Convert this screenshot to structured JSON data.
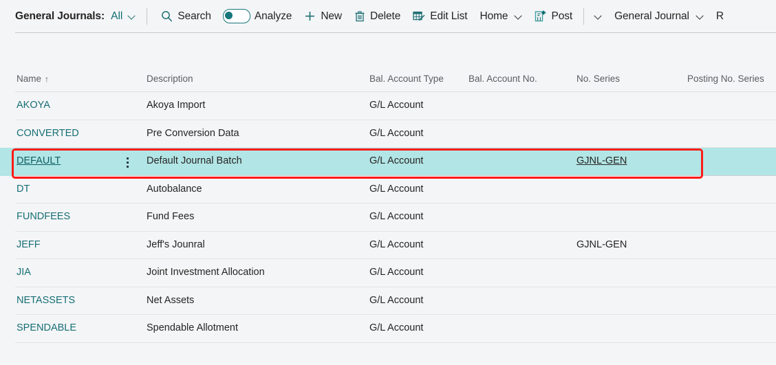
{
  "toolbar": {
    "page_title": "General Journals:",
    "filter_value": "All",
    "search_label": "Search",
    "analyze_label": "Analyze",
    "analyze_toggle_state": "off",
    "new_label": "New",
    "delete_label": "Delete",
    "edit_list_label": "Edit List",
    "home_label": "Home",
    "post_label": "Post",
    "general_journal_label": "General Journal",
    "overflow_label": "R",
    "accent_color": "#17777c",
    "link_color": "#166f74"
  },
  "grid": {
    "columns": [
      {
        "key": "name",
        "label": "Name",
        "sorted": true,
        "sort_indicator": "↑"
      },
      {
        "key": "description",
        "label": "Description"
      },
      {
        "key": "bal_account_type",
        "label": "Bal. Account Type"
      },
      {
        "key": "bal_account_no",
        "label": "Bal. Account No."
      },
      {
        "key": "no_series",
        "label": "No. Series"
      },
      {
        "key": "posting_no_series",
        "label": "Posting No. Series"
      }
    ],
    "rows": [
      {
        "name": "AKOYA",
        "description": "Akoya Import",
        "bal_account_type": "G/L Account",
        "bal_account_no": "",
        "no_series": "",
        "posting_no_series": "",
        "selected": false
      },
      {
        "name": "CONVERTED",
        "description": "Pre Conversion Data",
        "bal_account_type": "G/L Account",
        "bal_account_no": "",
        "no_series": "",
        "posting_no_series": "",
        "selected": false
      },
      {
        "name": "DEFAULT",
        "description": "Default Journal Batch",
        "bal_account_type": "G/L Account",
        "bal_account_no": "",
        "no_series": "GJNL-GEN",
        "posting_no_series": "",
        "selected": true
      },
      {
        "name": "DT",
        "description": "Autobalance",
        "bal_account_type": "G/L Account",
        "bal_account_no": "",
        "no_series": "",
        "posting_no_series": "",
        "selected": false
      },
      {
        "name": "FUNDFEES",
        "description": "Fund Fees",
        "bal_account_type": "G/L Account",
        "bal_account_no": "",
        "no_series": "",
        "posting_no_series": "",
        "selected": false
      },
      {
        "name": "JEFF",
        "description": "Jeff's Jounral",
        "bal_account_type": "G/L Account",
        "bal_account_no": "",
        "no_series": "GJNL-GEN",
        "posting_no_series": "",
        "selected": false
      },
      {
        "name": "JIA",
        "description": "Joint Investment Allocation",
        "bal_account_type": "G/L Account",
        "bal_account_no": "",
        "no_series": "",
        "posting_no_series": "",
        "selected": false
      },
      {
        "name": "NETASSETS",
        "description": "Net Assets",
        "bal_account_type": "G/L Account",
        "bal_account_no": "",
        "no_series": "",
        "posting_no_series": "",
        "selected": false
      },
      {
        "name": "SPENDABLE",
        "description": "Spendable Allotment",
        "bal_account_type": "G/L Account",
        "bal_account_no": "",
        "no_series": "",
        "posting_no_series": "",
        "selected": false
      }
    ]
  },
  "annotation": {
    "highlight_color": "#ff1a16",
    "selected_row_color": "#b2e5e5"
  }
}
